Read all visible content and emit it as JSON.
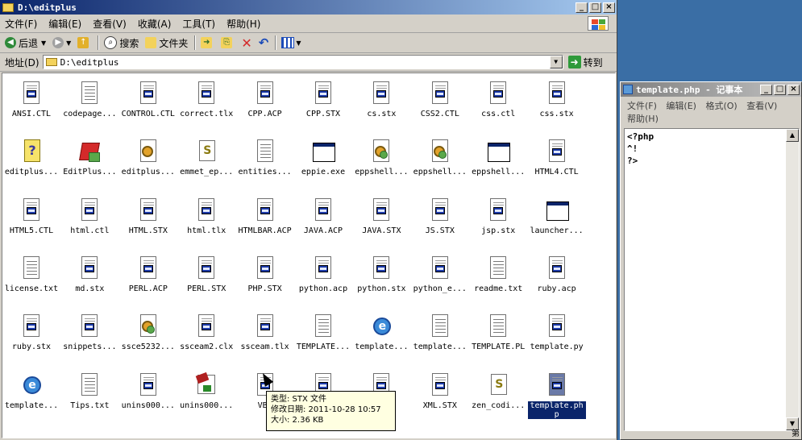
{
  "explorer": {
    "title": "D:\\editplus",
    "menu": [
      "文件(F)",
      "编辑(E)",
      "查看(V)",
      "收藏(A)",
      "工具(T)",
      "帮助(H)"
    ],
    "toolbar": {
      "back": "后退",
      "search": "搜索",
      "folders": "文件夹"
    },
    "address": {
      "label": "地址(D)",
      "value": "D:\\editplus",
      "go": "转到"
    },
    "files": [
      {
        "name": "ANSI.CTL",
        "icon": "doc-icon"
      },
      {
        "name": "codepage...",
        "icon": "text-icon"
      },
      {
        "name": "CONTROL.CTL",
        "icon": "doc-icon"
      },
      {
        "name": "correct.tlx",
        "icon": "doc-icon"
      },
      {
        "name": "CPP.ACP",
        "icon": "doc-icon"
      },
      {
        "name": "CPP.STX",
        "icon": "doc-icon"
      },
      {
        "name": "cs.stx",
        "icon": "doc-icon"
      },
      {
        "name": "CSS2.CTL",
        "icon": "doc-icon"
      },
      {
        "name": "css.ctl",
        "icon": "doc-icon"
      },
      {
        "name": "css.stx",
        "icon": "doc-icon"
      },
      {
        "name": "editplus...",
        "icon": "help-icon"
      },
      {
        "name": "EditPlus...",
        "icon": "editplus-icon"
      },
      {
        "name": "editplus...",
        "icon": "settings-file-icon"
      },
      {
        "name": "emmet_ep...",
        "icon": "script-icon"
      },
      {
        "name": "entities...",
        "icon": "text-icon"
      },
      {
        "name": "eppie.exe",
        "icon": "exe-icon"
      },
      {
        "name": "eppshell...",
        "icon": "dll-icon"
      },
      {
        "name": "eppshell...",
        "icon": "dll-icon"
      },
      {
        "name": "eppshell...",
        "icon": "exe-icon"
      },
      {
        "name": "HTML4.CTL",
        "icon": "doc-icon"
      },
      {
        "name": "HTML5.CTL",
        "icon": "doc-icon"
      },
      {
        "name": "html.ctl",
        "icon": "doc-icon"
      },
      {
        "name": "HTML.STX",
        "icon": "doc-icon"
      },
      {
        "name": "html.tlx",
        "icon": "doc-icon"
      },
      {
        "name": "HTMLBAR.ACP",
        "icon": "doc-icon"
      },
      {
        "name": "JAVA.ACP",
        "icon": "doc-icon"
      },
      {
        "name": "JAVA.STX",
        "icon": "doc-icon"
      },
      {
        "name": "JS.STX",
        "icon": "doc-icon"
      },
      {
        "name": "jsp.stx",
        "icon": "doc-icon"
      },
      {
        "name": "launcher...",
        "icon": "exe-icon"
      },
      {
        "name": "license.txt",
        "icon": "text-icon"
      },
      {
        "name": "md.stx",
        "icon": "doc-icon"
      },
      {
        "name": "PERL.ACP",
        "icon": "doc-icon"
      },
      {
        "name": "PERL.STX",
        "icon": "doc-icon"
      },
      {
        "name": "PHP.STX",
        "icon": "doc-icon"
      },
      {
        "name": "python.acp",
        "icon": "doc-icon"
      },
      {
        "name": "python.stx",
        "icon": "doc-icon"
      },
      {
        "name": "python_e...",
        "icon": "doc-icon"
      },
      {
        "name": "readme.txt",
        "icon": "text-icon"
      },
      {
        "name": "ruby.acp",
        "icon": "doc-icon"
      },
      {
        "name": "ruby.stx",
        "icon": "doc-icon"
      },
      {
        "name": "snippets...",
        "icon": "doc-icon"
      },
      {
        "name": "ssce5232...",
        "icon": "dll-icon"
      },
      {
        "name": "ssceam2.clx",
        "icon": "doc-icon"
      },
      {
        "name": "ssceam.tlx",
        "icon": "doc-icon"
      },
      {
        "name": "TEMPLATE...",
        "icon": "text-icon"
      },
      {
        "name": "template...",
        "icon": "ie-icon"
      },
      {
        "name": "template...",
        "icon": "text-icon"
      },
      {
        "name": "TEMPLATE.PL",
        "icon": "text-icon"
      },
      {
        "name": "template.py",
        "icon": "doc-icon"
      },
      {
        "name": "template...",
        "icon": "ie-icon"
      },
      {
        "name": "Tips.txt",
        "icon": "text-icon"
      },
      {
        "name": "unins000...",
        "icon": "doc-icon"
      },
      {
        "name": "unins000...",
        "icon": "installer-icon"
      },
      {
        "name": "VB.",
        "icon": "doc-icon"
      },
      {
        "name": "",
        "icon": "doc-icon"
      },
      {
        "name": "...",
        "icon": "doc-icon"
      },
      {
        "name": "XML.STX",
        "icon": "doc-icon"
      },
      {
        "name": "zen_codi...",
        "icon": "script-icon"
      },
      {
        "name": "template.php",
        "icon": "doc-icon",
        "selected": true
      }
    ],
    "tooltip": {
      "type": "类型: STX 文件",
      "modified": "修改日期: 2011-10-28 10:57",
      "size": "大小: 2.36 KB"
    }
  },
  "notepad": {
    "title": "template.php - 记事本",
    "menu": [
      "文件(F)",
      "编辑(E)",
      "格式(O)",
      "查看(V)",
      "帮助(H)"
    ],
    "content": "<?php\n^!\n?>",
    "status": "第"
  },
  "colors": {
    "title_active": "#0a246a",
    "title_inactive": "#808080",
    "face": "#d4d0c8",
    "desktop": "#3a6ea5",
    "tooltip": "#ffffe1"
  }
}
